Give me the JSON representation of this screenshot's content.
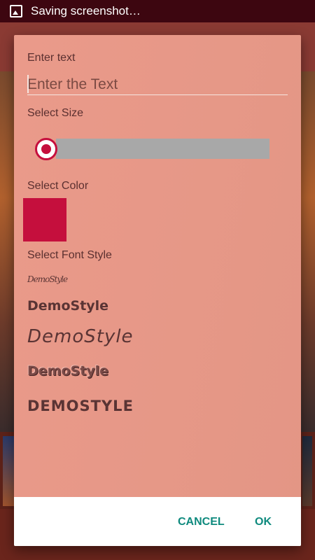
{
  "status_bar": {
    "notification_icon": "image-icon",
    "text": "Saving screenshot…"
  },
  "dialog": {
    "enter_text_label": "Enter text",
    "text_input_placeholder": "Enter the Text",
    "text_input_value": "",
    "select_size_label": "Select Size",
    "size_slider_value": 0,
    "select_color_label": "Select Color",
    "selected_color": "#c50f3d",
    "select_font_style_label": "Select Font Style",
    "font_styles": [
      "DemoStyle",
      "DemoStyle",
      "DemoStyle",
      "DemoStyle",
      "DEMOSTYLE"
    ],
    "cancel_label": "CANCEL",
    "ok_label": "OK"
  },
  "colors": {
    "dialog_background": "#e89888",
    "accent": "#c50f3d",
    "button_text": "#0f8a7e"
  }
}
